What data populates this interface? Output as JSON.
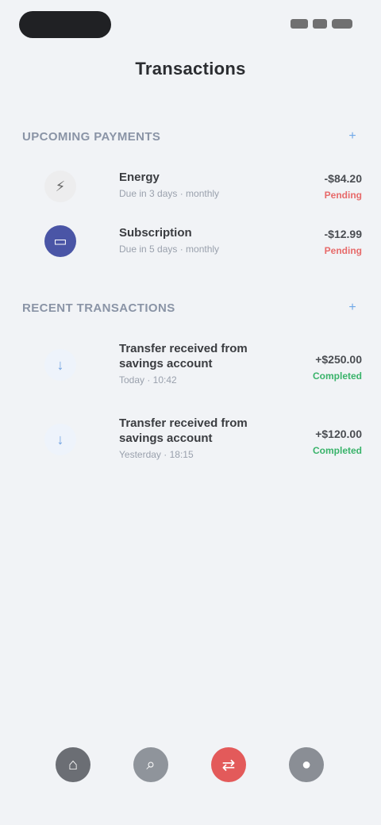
{
  "status_bar": {
    "icons": [
      "signal-icon",
      "wifi-icon",
      "battery-icon"
    ]
  },
  "header": {
    "title": "Transactions"
  },
  "sections": [
    {
      "title": "Upcoming payments",
      "action_icon": "add-icon",
      "items": [
        {
          "icon": "bolt-icon",
          "title": "Energy",
          "subtitle": "Due in 3 days · monthly",
          "amount": "-$84.20",
          "status": "Pending",
          "status_color": "#e76a6a"
        },
        {
          "icon": "card-icon",
          "title": "Subscription",
          "subtitle": "Due in 5 days · monthly",
          "amount": "-$12.99",
          "status": "Pending",
          "status_color": "#e76a6a"
        }
      ]
    },
    {
      "title": "Recent transactions",
      "action_icon": "add-icon",
      "items": [
        {
          "icon": "arrow-icon",
          "title": "Transfer received from savings account",
          "subtitle": "Today · 10:42",
          "amount": "+$250.00",
          "status": "Completed",
          "status_color": "#39b36a"
        },
        {
          "icon": "arrow-icon",
          "title": "Transfer received from savings account",
          "subtitle": "Yesterday · 18:15",
          "amount": "+$120.00",
          "status": "Completed",
          "status_color": "#39b36a"
        }
      ]
    }
  ],
  "bottom_nav": {
    "items": [
      {
        "icon": "home-icon",
        "color": "#6b6e74"
      },
      {
        "icon": "search-icon",
        "color": "#8f949b"
      },
      {
        "icon": "transfer-icon",
        "color": "#e35a5a"
      },
      {
        "icon": "profile-icon",
        "color": "#8a8e95"
      }
    ]
  }
}
